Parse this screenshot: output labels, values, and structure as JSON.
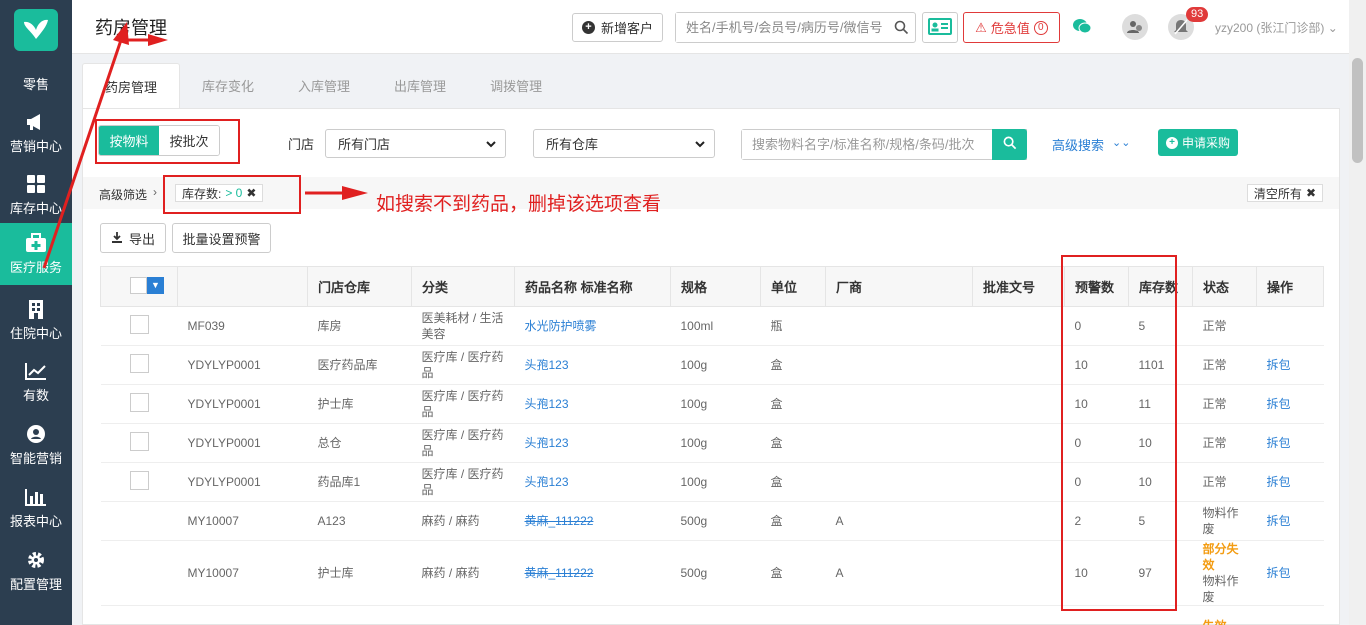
{
  "app": {
    "accent": "#1abc9c",
    "sidebar_bg": "#2c3e50",
    "annotation_color": "#e02020"
  },
  "sidebar": {
    "items": [
      {
        "label": "零售",
        "icon": "retail-icon"
      },
      {
        "label": "营销中心",
        "icon": "megaphone-icon"
      },
      {
        "label": "库存中心",
        "icon": "grid-icon"
      },
      {
        "label": "医疗服务",
        "icon": "medical-kit-icon",
        "active": true
      },
      {
        "label": "住院中心",
        "icon": "hospital-icon"
      },
      {
        "label": "有数",
        "icon": "trend-icon"
      },
      {
        "label": "智能营销",
        "icon": "smart-marketing-icon"
      },
      {
        "label": "报表中心",
        "icon": "bar-chart-icon"
      },
      {
        "label": "配置管理",
        "icon": "gear-icon"
      }
    ]
  },
  "header": {
    "title": "药房管理",
    "new_customer": "新增客户",
    "search_placeholder": "姓名/手机号/会员号/病历号/微信号",
    "alert_label": "危急值",
    "alert_count": "0",
    "notification_count": "93",
    "user": "yzy200 (张江门诊部)"
  },
  "tabs": [
    {
      "label": "药房管理",
      "active": true
    },
    {
      "label": "库存变化"
    },
    {
      "label": "入库管理"
    },
    {
      "label": "出库管理"
    },
    {
      "label": "调拨管理"
    }
  ],
  "toolbar": {
    "mode_material": "按物料",
    "mode_batch": "按批次",
    "store_label": "门店",
    "store_select": "所有门店",
    "warehouse_select": "所有仓库",
    "search_placeholder": "搜索物料名字/标准名称/规格/条码/批次",
    "advanced_search": "高级搜索",
    "purchase_request": "申请采购"
  },
  "filters": {
    "label": "高级筛选",
    "tag_name": "库存数:",
    "tag_value": "> 0",
    "clear_all": "清空所有"
  },
  "actions": {
    "export": "导出",
    "batch_alert": "批量设置预警"
  },
  "annotation": {
    "text": "如搜索不到药品，删掉该选项查看"
  },
  "table": {
    "columns": [
      "",
      "",
      "门店仓库",
      "分类",
      "药品名称 标准名称",
      "规格",
      "单位",
      "厂商",
      "批准文号",
      "预警数",
      "库存数",
      "状态",
      "操作"
    ],
    "rows": [
      {
        "code": "MF039",
        "store": "库房",
        "category": "医美耗材 / 生活美容",
        "name": "水光防护喷雾",
        "spec": "100ml",
        "unit": "瓶",
        "maker": "",
        "approval": "",
        "warn": "0",
        "stock": "5",
        "status": "正常",
        "status2": "",
        "action": "",
        "checkbox": true,
        "strike": false
      },
      {
        "code": "YDYLYP0001",
        "store": "医疗药品库",
        "category": "医疗库 / 医疗药品",
        "name": "头孢123",
        "spec": "100g",
        "unit": "盒",
        "maker": "",
        "approval": "",
        "warn": "10",
        "stock": "1101",
        "status": "正常",
        "status2": "",
        "action": "拆包",
        "checkbox": true,
        "strike": false
      },
      {
        "code": "YDYLYP0001",
        "store": "护士库",
        "category": "医疗库 / 医疗药品",
        "name": "头孢123",
        "spec": "100g",
        "unit": "盒",
        "maker": "",
        "approval": "",
        "warn": "10",
        "stock": "11",
        "status": "正常",
        "status2": "",
        "action": "拆包",
        "checkbox": true,
        "strike": false
      },
      {
        "code": "YDYLYP0001",
        "store": "总仓",
        "category": "医疗库 / 医疗药品",
        "name": "头孢123",
        "spec": "100g",
        "unit": "盒",
        "maker": "",
        "approval": "",
        "warn": "0",
        "stock": "10",
        "status": "正常",
        "status2": "",
        "action": "拆包",
        "checkbox": true,
        "strike": false
      },
      {
        "code": "YDYLYP0001",
        "store": "药品库1",
        "category": "医疗库 / 医疗药品",
        "name": "头孢123",
        "spec": "100g",
        "unit": "盒",
        "maker": "",
        "approval": "",
        "warn": "0",
        "stock": "10",
        "status": "正常",
        "status2": "",
        "action": "拆包",
        "checkbox": true,
        "strike": false
      },
      {
        "code": "MY10007",
        "store": "A123",
        "category": "麻药 / 麻药",
        "name": "黄麻_111222",
        "spec": "500g",
        "unit": "盒",
        "maker": "A",
        "approval": "",
        "warn": "2",
        "stock": "5",
        "status": "物料作废",
        "status2": "",
        "action": "拆包",
        "checkbox": false,
        "strike": true
      },
      {
        "code": "MY10007",
        "store": "护士库",
        "category": "麻药 / 麻药",
        "name": "黄麻_111222",
        "spec": "500g",
        "unit": "盒",
        "maker": "A",
        "approval": "",
        "warn": "10",
        "stock": "97",
        "status": "部分失效",
        "status2": "物料作废",
        "action": "拆包",
        "checkbox": false,
        "strike": true
      },
      {
        "code": "",
        "store": "",
        "category": "",
        "name": "",
        "spec": "",
        "unit": "",
        "maker": "",
        "approval": "",
        "warn": "",
        "stock": "",
        "status": "失效",
        "status2": "",
        "action": "",
        "checkbox": false,
        "strike": false
      }
    ]
  }
}
